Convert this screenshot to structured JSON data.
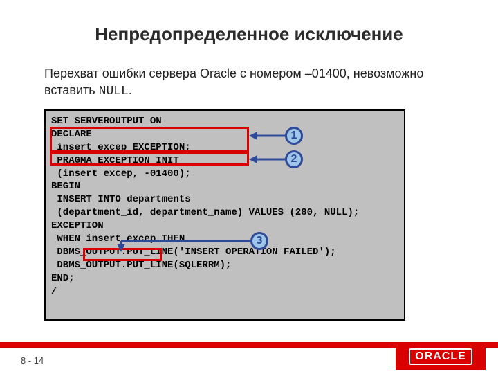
{
  "title": "Непредопределенное исключение",
  "body": {
    "pre": "Перехват ошибки сервера Oracle с номером  –01400, невозможно вставить ",
    "mono": "NULL",
    "post": "."
  },
  "code": {
    "l1": "SET SERVEROUTPUT ON",
    "l2": "DECLARE",
    "l3": " insert_excep EXCEPTION;",
    "l4": " PRAGMA EXCEPTION_INIT",
    "l5": " (insert_excep, -01400);",
    "l6": "BEGIN",
    "l7": " INSERT INTO departments",
    "l8": " (department_id, department_name) VALUES (280, NULL);",
    "l9": "EXCEPTION",
    "l10": " WHEN insert_excep THEN",
    "l11": " DBMS_OUTPUT.PUT_LINE('INSERT OPERATION FAILED');",
    "l12": " DBMS_OUTPUT.PUT_LINE(SQLERRM);",
    "l13": "END;",
    "l14": "/"
  },
  "callouts": {
    "c1": "1",
    "c2": "2",
    "c3": "3"
  },
  "pagenum": "8 - 14",
  "logo": "ORACLE"
}
